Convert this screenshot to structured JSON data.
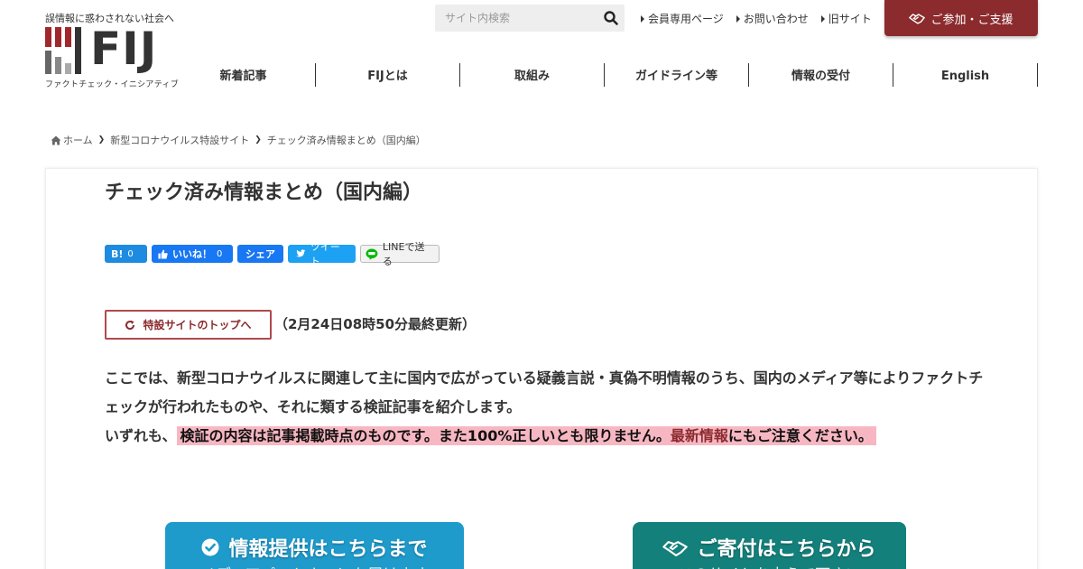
{
  "header": {
    "tagline": "誤情報に惑わされない社会へ",
    "logo_text": "FIJ",
    "logo_sub": "ファクトチェック・イニシアティブ",
    "search_placeholder": "サイト内検索",
    "top_links": [
      "会員専用ページ",
      "お問い合わせ",
      "旧サイト"
    ],
    "join_label": "ご参加・ご支援",
    "nav": [
      "新着記事",
      "FIJとは",
      "取組み",
      "ガイドライン等",
      "情報の受付",
      "English"
    ]
  },
  "breadcrumb": {
    "home": "ホーム",
    "level1": "新型コロナウイルス特設サイト",
    "current": "チェック済み情報まとめ（国内編）"
  },
  "article": {
    "title": "チェック済み情報まとめ（国内編）",
    "share": {
      "hatena_label": "B!",
      "hatena_count": "0",
      "like_label": "いいね！",
      "like_count": "0",
      "share_label": "シェア",
      "tweet_label": "ツイート",
      "line_label": "LINEで送る"
    },
    "top_button": "特設サイトのトップへ",
    "updated": "（2月24日08時50分最終更新）",
    "para1": "ここでは、新型コロナウイルスに関連して主に国内で広がっている疑義言説・真偽不明情報のうち、国内のメディア等によりファクトチェックが行われたものや、それに類する検証記事を紹介します。",
    "para2_lead": "いずれも、",
    "para2_hl_a": "検証の内容は記事掲載時点のものです。また100%正しいとも限りません。",
    "para2_hl_link": "最新情報",
    "para2_hl_b": "にもご注意ください。"
  },
  "cta": {
    "info_main": "情報提供はこちらまで",
    "info_sub": "メディアパートナーにも届けます",
    "donate_main": "ご寄付はこちらから",
    "donate_sub": "このサイトを支えて下さい"
  },
  "colors": {
    "brand": "#8b2b2e",
    "highlight": "#f7b7c2",
    "cta_blue": "#1e9acb",
    "cta_green": "#14807b"
  }
}
